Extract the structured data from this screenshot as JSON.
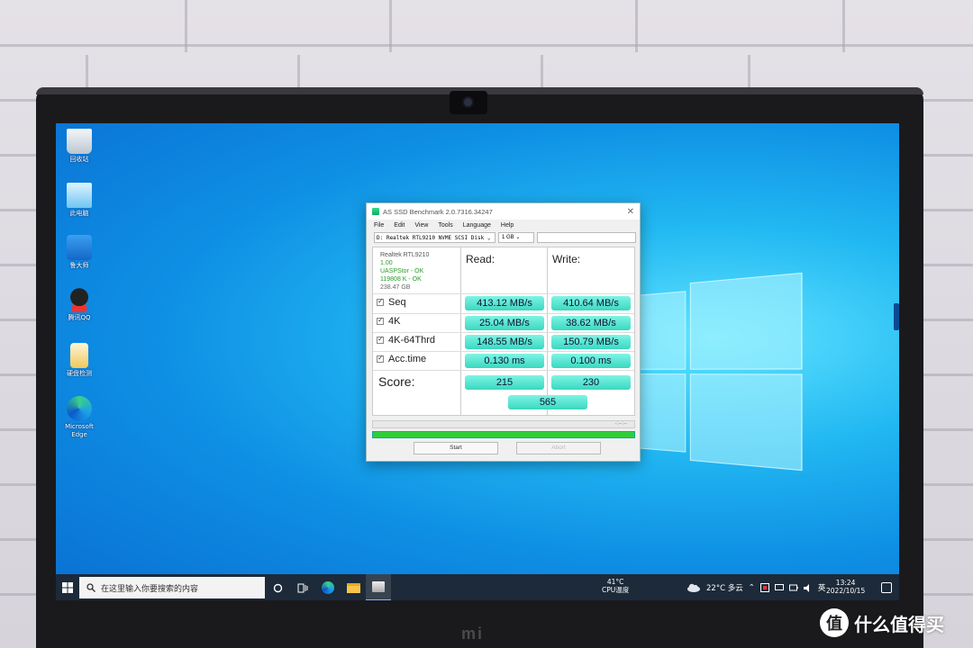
{
  "desktop": {
    "icons": [
      {
        "label": "回收站",
        "icon": "recycle-bin-icon"
      },
      {
        "label": "此电脑",
        "icon": "this-pc-icon"
      },
      {
        "label": "鲁大师",
        "icon": "ludashi-icon"
      },
      {
        "label": "腾讯QQ",
        "icon": "qq-icon"
      },
      {
        "label": "硬盘检测",
        "icon": "disk-check-icon"
      },
      {
        "label": "Microsoft Edge",
        "icon": "edge-icon"
      }
    ]
  },
  "app": {
    "title": "AS SSD Benchmark 2.0.7316.34247",
    "menu": [
      "File",
      "Edit",
      "View",
      "Tools",
      "Language",
      "Help"
    ],
    "drive_select": "D: Realtek RTL9210 NVME SCSI Disk",
    "size_select": "1 GB",
    "info": {
      "name": "Realtek RTL9210",
      "version": "1.00",
      "driver": "UASPStor - OK",
      "alignment": "119808 K - OK",
      "capacity": "238.47 GB"
    },
    "columns": {
      "read": "Read:",
      "write": "Write:"
    },
    "rows": [
      {
        "label": "Seq",
        "read": "413.12 MB/s",
        "write": "410.64 MB/s"
      },
      {
        "label": "4K",
        "read": "25.04 MB/s",
        "write": "38.62 MB/s"
      },
      {
        "label": "4K-64Thrd",
        "read": "148.55 MB/s",
        "write": "150.79 MB/s"
      },
      {
        "label": "Acc.time",
        "read": "0.130 ms",
        "write": "0.100 ms"
      }
    ],
    "score": {
      "label": "Score:",
      "read": "215",
      "write": "230",
      "total": "565"
    },
    "time_placeholder": "-:--:--",
    "progress": 1.0,
    "buttons": {
      "start": "Start",
      "abort": "Abort"
    }
  },
  "taskbar": {
    "search_placeholder": "在这里输入你要搜索的内容",
    "cpu_temp": "41°C",
    "cpu_label": "CPU温度",
    "weather": "22°C 多云",
    "ime": "英",
    "time": "13:24",
    "date": "2022/10/15"
  },
  "watermark": {
    "logo": "值",
    "text": "什么值得买"
  },
  "brand": {
    "logo": "mi"
  }
}
